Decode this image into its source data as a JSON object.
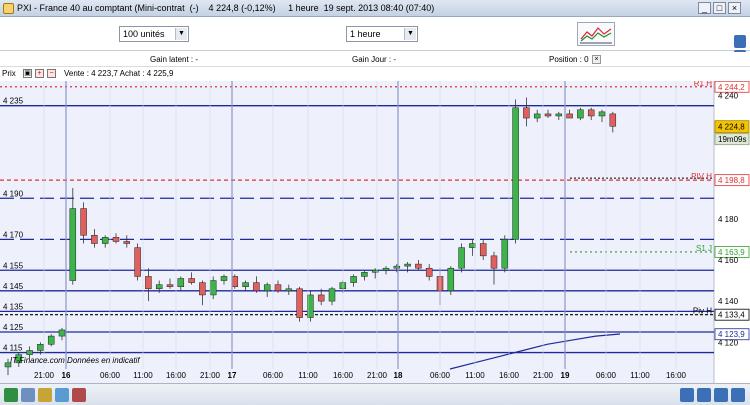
{
  "window": {
    "title": "PXI - France 40 au comptant (Mini-contrat  (-)    4 224,8 (-0,12%)     1 heure  19 sept. 2013 08:40 (07:40)",
    "buttons": [
      "_",
      "□",
      "×"
    ]
  },
  "toolbar": {
    "quantity": "100 unités",
    "period": "1 heure"
  },
  "position_bar": {
    "gain_latent": "Gain latent : -",
    "gain_jour": "Gain Jour : -",
    "position": "Position : 0"
  },
  "price_bar": {
    "label": "Prix",
    "quote": "Vente : 4 223,7  Achat : 4 225,9"
  },
  "watermark": "IT-Finance.com  Données en indicatif",
  "colors": {
    "background_chart": "#eef0fb",
    "blue_line": "#1f2a9a",
    "red_dashed": "#e03030",
    "green_dashed": "#30a030",
    "black_dashed": "#000000",
    "candle_up": "#3cb44b",
    "candle_down": "#e06060",
    "last_price_bg": "#f5c400"
  },
  "chart_data": {
    "type": "candlestick",
    "instrument": "France 40 au comptant (Mini-contrat)",
    "period": "1 heure",
    "y_axis_right": [
      "4 240",
      "4 180",
      "4 160",
      "4 140",
      "4 120"
    ],
    "y_axis_left": [
      "4 235",
      "4 190",
      "4 170",
      "4 155",
      "4 145",
      "4 135",
      "4 125",
      "4 115"
    ],
    "ylim": [
      4107,
      4247
    ],
    "x_tick_labels": [
      "21:00",
      "16",
      "06:00",
      "11:00",
      "16:00",
      "21:00",
      "17",
      "06:00",
      "11:00",
      "16:00",
      "21:00",
      "18",
      "06:00",
      "11:00",
      "16:00",
      "21:00",
      "19",
      "06:00",
      "11:00",
      "16:00"
    ],
    "levels": [
      {
        "label": "R1 H",
        "value": 4244.2,
        "style": "red-dotted",
        "tag": "4 244,2"
      },
      {
        "label": "PIV H",
        "value": 4198.8,
        "style": "red-dashed",
        "tag": "4 198,8"
      },
      {
        "label": "S1 J",
        "value": 4163.9,
        "style": "green-dotted",
        "tag": "4 163,9"
      },
      {
        "label": "Piv H",
        "value": 4133.4,
        "style": "black-dashed",
        "tag": "4 133,4"
      },
      {
        "label": "",
        "value": 4123.9,
        "style": "blue",
        "tag": "4 123,9"
      }
    ],
    "horizontal_lines": [
      4235,
      4190,
      4170,
      4155,
      4145,
      4135,
      4125,
      4115
    ],
    "last_price": "4 224,8",
    "countdown": "19m09s",
    "candles": [
      {
        "o": 4108,
        "h": 4112,
        "l": 4104,
        "c": 4110
      },
      {
        "o": 4110,
        "h": 4115,
        "l": 4108,
        "c": 4114
      },
      {
        "o": 4114,
        "h": 4118,
        "l": 4112,
        "c": 4116
      },
      {
        "o": 4116,
        "h": 4120,
        "l": 4114,
        "c": 4119
      },
      {
        "o": 4119,
        "h": 4124,
        "l": 4118,
        "c": 4123
      },
      {
        "o": 4123,
        "h": 4127,
        "l": 4121,
        "c": 4126
      },
      {
        "o": 4150,
        "h": 4195,
        "l": 4148,
        "c": 4185
      },
      {
        "o": 4185,
        "h": 4188,
        "l": 4168,
        "c": 4172
      },
      {
        "o": 4172,
        "h": 4175,
        "l": 4166,
        "c": 4168
      },
      {
        "o": 4168,
        "h": 4172,
        "l": 4166,
        "c": 4171
      },
      {
        "o": 4171,
        "h": 4173,
        "l": 4168,
        "c": 4169
      },
      {
        "o": 4169,
        "h": 4172,
        "l": 4166,
        "c": 4168
      },
      {
        "o": 4166,
        "h": 4168,
        "l": 4150,
        "c": 4152
      },
      {
        "o": 4152,
        "h": 4156,
        "l": 4140,
        "c": 4146
      },
      {
        "o": 4146,
        "h": 4150,
        "l": 4144,
        "c": 4148
      },
      {
        "o": 4148,
        "h": 4151,
        "l": 4146,
        "c": 4147
      },
      {
        "o": 4147,
        "h": 4152,
        "l": 4145,
        "c": 4151
      },
      {
        "o": 4151,
        "h": 4154,
        "l": 4148,
        "c": 4149
      },
      {
        "o": 4149,
        "h": 4150,
        "l": 4138,
        "c": 4143
      },
      {
        "o": 4143,
        "h": 4152,
        "l": 4141,
        "c": 4150
      },
      {
        "o": 4150,
        "h": 4153,
        "l": 4148,
        "c": 4152
      },
      {
        "o": 4152,
        "h": 4153,
        "l": 4146,
        "c": 4147
      },
      {
        "o": 4147,
        "h": 4150,
        "l": 4145,
        "c": 4149
      },
      {
        "o": 4149,
        "h": 4152,
        "l": 4144,
        "c": 4145
      },
      {
        "o": 4145,
        "h": 4149,
        "l": 4142,
        "c": 4148
      },
      {
        "o": 4148,
        "h": 4150,
        "l": 4144,
        "c": 4145
      },
      {
        "o": 4145,
        "h": 4148,
        "l": 4143,
        "c": 4146
      },
      {
        "o": 4146,
        "h": 4147,
        "l": 4130,
        "c": 4132
      },
      {
        "o": 4132,
        "h": 4145,
        "l": 4130,
        "c": 4143
      },
      {
        "o": 4143,
        "h": 4146,
        "l": 4138,
        "c": 4140
      },
      {
        "o": 4140,
        "h": 4147,
        "l": 4138,
        "c": 4146
      },
      {
        "o": 4146,
        "h": 4150,
        "l": 4144,
        "c": 4149
      },
      {
        "o": 4149,
        "h": 4153,
        "l": 4147,
        "c": 4152
      },
      {
        "o": 4152,
        "h": 4155,
        "l": 4150,
        "c": 4154
      },
      {
        "o": 4154,
        "h": 4156,
        "l": 4151,
        "c": 4155
      },
      {
        "o": 4155,
        "h": 4157,
        "l": 4153,
        "c": 4156
      },
      {
        "o": 4156,
        "h": 4158,
        "l": 4154,
        "c": 4157
      },
      {
        "o": 4157,
        "h": 4159,
        "l": 4154,
        "c": 4158
      },
      {
        "o": 4158,
        "h": 4160,
        "l": 4155,
        "c": 4156
      },
      {
        "o": 4156,
        "h": 4158,
        "l": 4150,
        "c": 4152
      },
      {
        "o": 4152,
        "h": 4156,
        "l": 4138,
        "c": 4145
      },
      {
        "o": 4145,
        "h": 4157,
        "l": 4143,
        "c": 4156
      },
      {
        "o": 4156,
        "h": 4168,
        "l": 4154,
        "c": 4166
      },
      {
        "o": 4166,
        "h": 4170,
        "l": 4162,
        "c": 4168
      },
      {
        "o": 4168,
        "h": 4170,
        "l": 4160,
        "c": 4162
      },
      {
        "o": 4162,
        "h": 4164,
        "l": 4148,
        "c": 4156
      },
      {
        "o": 4156,
        "h": 4172,
        "l": 4154,
        "c": 4170
      },
      {
        "o": 4170,
        "h": 4238,
        "l": 4168,
        "c": 4234
      },
      {
        "o": 4234,
        "h": 4239,
        "l": 4225,
        "c": 4229
      },
      {
        "o": 4229,
        "h": 4233,
        "l": 4227,
        "c": 4231
      },
      {
        "o": 4231,
        "h": 4233,
        "l": 4229,
        "c": 4230
      },
      {
        "o": 4230,
        "h": 4232,
        "l": 4228,
        "c": 4231
      },
      {
        "o": 4231,
        "h": 4233,
        "l": 4229,
        "c": 4229
      },
      {
        "o": 4229,
        "h": 4234,
        "l": 4228,
        "c": 4233
      },
      {
        "o": 4233,
        "h": 4234,
        "l": 4228,
        "c": 4230
      },
      {
        "o": 4230,
        "h": 4233,
        "l": 4227,
        "c": 4232
      },
      {
        "o": 4231,
        "h": 4232,
        "l": 4222,
        "c": 4225
      }
    ],
    "moving_average": [
      4107,
      4110,
      4113,
      4116,
      4119,
      4121,
      4123,
      4124
    ]
  }
}
